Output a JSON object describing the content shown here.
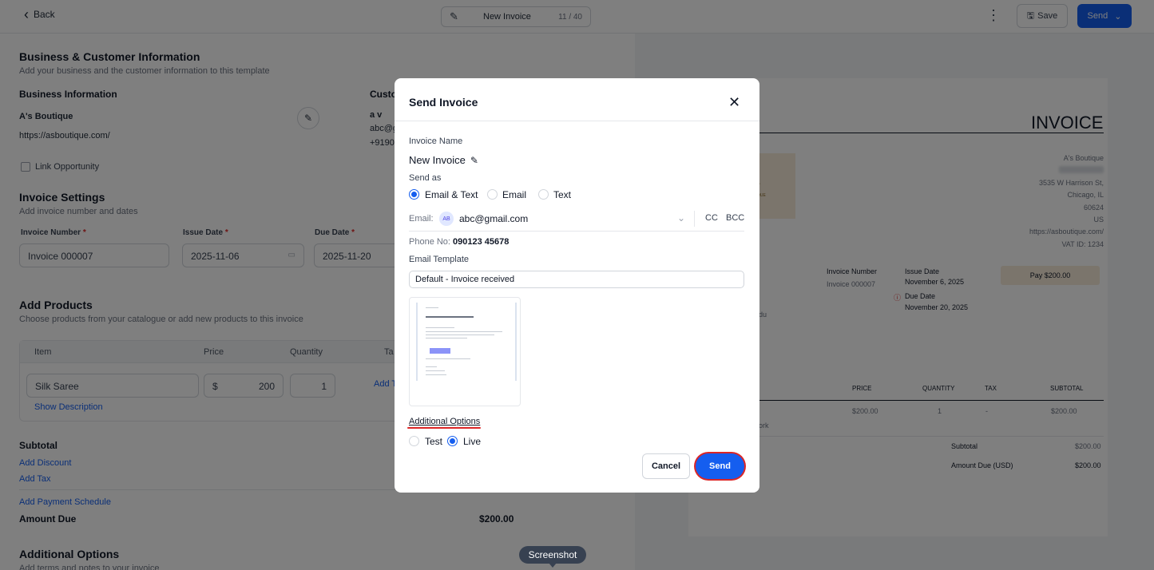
{
  "topbar": {
    "back_label": "Back",
    "invoice_title": "New Invoice",
    "title_counter": "11 / 40",
    "save_label": "Save",
    "send_label": "Send"
  },
  "left": {
    "business_customer": {
      "title": "Business & Customer Information",
      "subtitle": "Add your business and the customer information to this template",
      "business_heading": "Business Information",
      "business_name": "A's Boutique",
      "business_url": "https://asboutique.com/",
      "customer_heading": "Custo",
      "customer_name": "a v",
      "customer_email": "abc@g",
      "customer_phone": "+9190",
      "link_opportunity": "Link Opportunity"
    },
    "invoice_settings": {
      "title": "Invoice Settings",
      "subtitle": "Add invoice number and dates",
      "number_label": "Invoice Number",
      "number_value": "Invoice 000007",
      "issue_label": "Issue Date",
      "issue_value": "2025-11-06",
      "due_label": "Due Date",
      "due_value": "2025-11-20",
      "required_mark": "*"
    },
    "products": {
      "title": "Add Products",
      "subtitle": "Choose products from your catalogue or add new products to this invoice",
      "col_item": "Item",
      "col_price": "Price",
      "col_quantity": "Quantity",
      "col_tax": "Ta",
      "item_name": "Silk Saree",
      "currency": "$",
      "price": "200",
      "quantity": "1",
      "add_tax_short": "Add T",
      "show_description": "Show Description"
    },
    "totals": {
      "subtotal_label": "Subtotal",
      "add_discount": "Add Discount",
      "add_tax": "Add Tax",
      "add_payment_schedule": "Add Payment Schedule",
      "amount_due_label": "Amount Due",
      "amount_due_value": "$200.00"
    },
    "additional": {
      "title": "Additional Options",
      "subtitle": "Add terms and notes to your invoice"
    }
  },
  "preview": {
    "heading": "INVOICE",
    "logo_letter": "A",
    "logo_sub": "OUTIQUE",
    "business_name": "A's Boutique",
    "address_street": "3535 W Harrison St,",
    "address_city": "Chicago, IL",
    "address_zip": "60624",
    "address_country": "US",
    "website": "https://asboutique.com/",
    "vat": "VAT ID: 1234",
    "invoice_number_label": "Invoice Number",
    "invoice_number_value": "Invoice 000007",
    "issue_date_label": "Issue Date",
    "issue_date_value": "November 6, 2025",
    "due_date_label": "Due Date",
    "due_date_value": "November 20, 2025",
    "pay_button": "Pay $200.00",
    "partial_text": "du",
    "col_price": "PRICE",
    "col_quantity": "QUANTITY",
    "col_tax": "TAX",
    "col_subtotal": "SUBTOTAL",
    "row_price": "$200.00",
    "row_quantity": "1",
    "row_tax": "-",
    "row_subtotal": "$200.00",
    "row_partial": "ork",
    "subtotal_label": "Subtotal",
    "subtotal_value": "$200.00",
    "amount_due_label": "Amount Due (USD)",
    "amount_due_value": "$200.00"
  },
  "modal": {
    "title": "Send Invoice",
    "close_glyph": "✕",
    "invoice_name_label": "Invoice Name",
    "invoice_name_value": "New Invoice",
    "send_as_label": "Send as",
    "send_as_options": [
      "Email & Text",
      "Email",
      "Text"
    ],
    "send_as_selected": "Email & Text",
    "email_label": "Email:",
    "email_avatar": "AB",
    "email_value": "abc@gmail.com",
    "cc_label": "CC",
    "bcc_label": "BCC",
    "phone_label": "Phone No:",
    "phone_value": "090123 45678",
    "template_label": "Email Template",
    "template_value": "Default - Invoice received",
    "additional_options_label": "Additional Options",
    "mode_options": [
      "Test",
      "Live"
    ],
    "mode_selected": "Live",
    "cancel_label": "Cancel",
    "send_label": "Send"
  },
  "tooltip": {
    "label": "Screenshot"
  },
  "colors": {
    "accent": "#155eef",
    "highlight": "#dc2626",
    "pay_button": "#f6ebd9"
  },
  "icons": {
    "back": "chevron-left-icon",
    "title_edit": "pencil-icon",
    "menu": "kebab-menu-icon",
    "save": "save-icon",
    "send_dropdown": "chevron-down-icon",
    "close": "close-icon",
    "email_dropdown": "chevron-down-icon",
    "calendar": "calendar-icon",
    "due_warning": "warning-circle-icon"
  }
}
